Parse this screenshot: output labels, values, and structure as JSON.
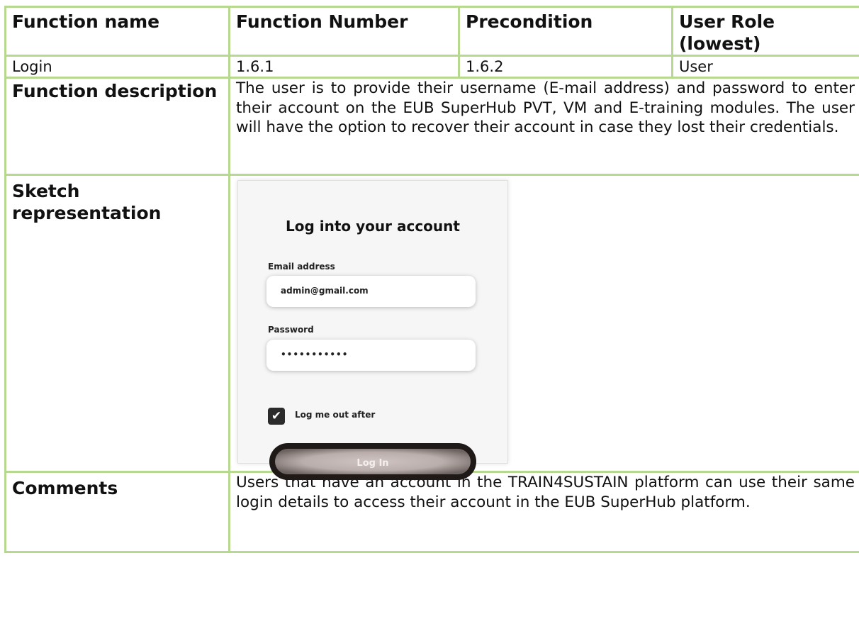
{
  "table": {
    "headers": [
      "Function name",
      "Function Number",
      "Precondition",
      "User Role (lowest)"
    ],
    "values": [
      "Login",
      "1.6.1",
      "1.6.2",
      "User"
    ],
    "description_label": "Function description",
    "description_text": "The user is to provide their username (E-mail address) and password to enter their account on the EUB SuperHub PVT, VM and E-training modules. The user will have the option to recover their account in case they lost their credentials.",
    "sketch_label": "Sketch representation",
    "comments_label": "Comments",
    "comments_text": "Users that have an account in the TRAIN4SUSTAIN platform can use their same login details to access their account in the EUB SuperHub platform."
  },
  "sketch": {
    "title": "Log into your account",
    "email_label": "Email address",
    "email_value": "admin@gmail.com",
    "password_label": "Password",
    "password_value": "•••••••••••",
    "checkbox_label": "Log me out after",
    "checkbox_checked": true,
    "login_button_label": "Log In"
  }
}
